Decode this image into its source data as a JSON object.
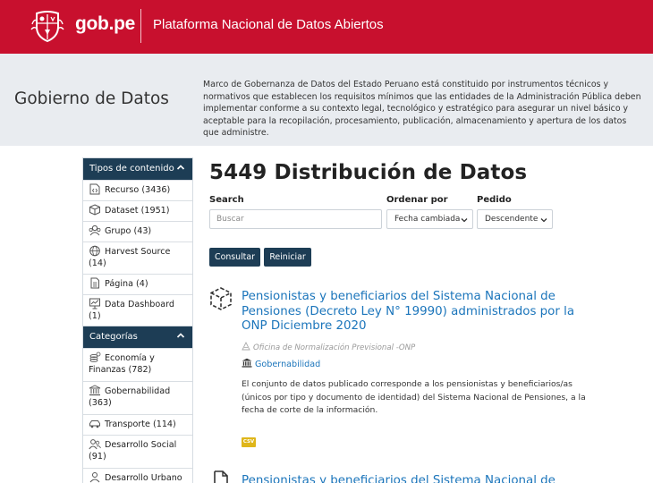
{
  "header": {
    "logo_text": "gob.pe",
    "platform_title": "Plataforma Nacional de Datos Abiertos"
  },
  "band": {
    "title": "Gobierno de Datos",
    "description": "Marco de Gobernanza de Datos del Estado Peruano está constituido por instrumentos técnicos y normativos que establecen los requisitos mínimos que las entidades de la Administración Pública deben implementar conforme a su contexto legal, tecnológico y estratégico para asegurar un nivel básico y aceptable para la recopilación, procesamiento, publicación, almacenamiento y apertura de los datos que administre."
  },
  "sidebar": {
    "content_types": {
      "heading": "Tipos de contenido",
      "items": [
        {
          "label": "Recurso (3436)",
          "icon": "code-file-icon"
        },
        {
          "label": "Dataset (1951)",
          "icon": "cube-icon"
        },
        {
          "label": "Grupo (43)",
          "icon": "group-icon"
        },
        {
          "label": "Harvest Source (14)",
          "icon": "globe-icon"
        },
        {
          "label": "Página (4)",
          "icon": "document-icon"
        },
        {
          "label": "Data Dashboard (1)",
          "icon": "dashboard-icon"
        }
      ]
    },
    "categories": {
      "heading": "Categorías",
      "items": [
        {
          "label": "Economía y Finanzas (782)",
          "icon": "coins-icon"
        },
        {
          "label": "Gobernabilidad (363)",
          "icon": "government-building-icon"
        },
        {
          "label": "Transporte (114)",
          "icon": "car-icon"
        },
        {
          "label": "Desarrollo Social (91)",
          "icon": "people-icon"
        },
        {
          "label": "Desarrollo Urbano",
          "icon": "person-icon"
        }
      ]
    }
  },
  "main": {
    "title": "5449 Distribución de Datos",
    "search_label": "Search",
    "search_placeholder": "Buscar",
    "sort_label": "Ordenar por",
    "sort_value": "Fecha cambiada",
    "order_label": "Pedido",
    "order_value": "Descendente",
    "submit_label": "Consultar",
    "reset_label": "Reiniciar"
  },
  "results": [
    {
      "title": "Pensionistas y beneficiarios del Sistema Nacional de Pensiones (Decreto Ley N° 19990) administrados por la ONP Diciembre 2020",
      "publisher": "Oficina de Normalización Previsional -ONP",
      "group": "Gobernabilidad",
      "description": "El conjunto de datos publicado corresponde a los pensionistas y beneficiarios/as (únicos por tipo y documento de identidad) del Sistema Nacional de Pensiones, a la fecha de corte de la información.",
      "format": "CSV"
    },
    {
      "title": "Pensionistas y beneficiarios del Sistema Nacional de"
    }
  ],
  "colors": {
    "brand_red": "#c8102e",
    "navy": "#1d3d55",
    "link_blue": "#1b75bb",
    "csv_gold": "#dfb61a"
  }
}
